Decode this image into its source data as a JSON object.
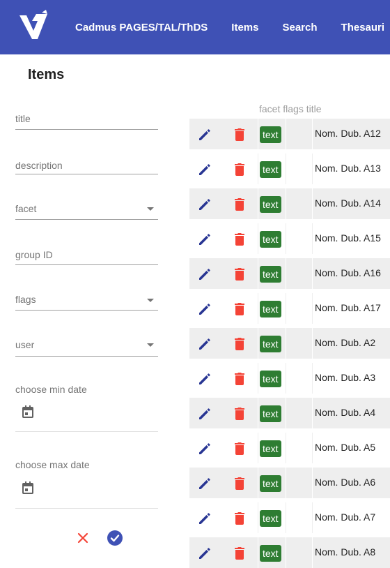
{
  "header": {
    "nav": [
      "Cadmus PAGES/TAL/ThDS",
      "Items",
      "Search",
      "Thesauri"
    ]
  },
  "page": {
    "title": "Items"
  },
  "filters": {
    "title_label": "title",
    "description_label": "description",
    "facet_label": "facet",
    "group_label": "group ID",
    "flags_label": "flags",
    "user_label": "user",
    "min_date_label": "choose min date",
    "max_date_label": "choose max date"
  },
  "table": {
    "header": "facet flags title",
    "rows": [
      {
        "flag": "text",
        "title": "Nom. Dub. A12"
      },
      {
        "flag": "text",
        "title": "Nom. Dub. A13"
      },
      {
        "flag": "text",
        "title": "Nom. Dub. A14"
      },
      {
        "flag": "text",
        "title": "Nom. Dub. A15"
      },
      {
        "flag": "text",
        "title": "Nom. Dub. A16"
      },
      {
        "flag": "text",
        "title": "Nom. Dub. A17"
      },
      {
        "flag": "text",
        "title": "Nom. Dub. A2"
      },
      {
        "flag": "text",
        "title": "Nom. Dub. A3"
      },
      {
        "flag": "text",
        "title": "Nom. Dub. A4"
      },
      {
        "flag": "text",
        "title": "Nom. Dub. A5"
      },
      {
        "flag": "text",
        "title": "Nom. Dub. A6"
      },
      {
        "flag": "text",
        "title": "Nom. Dub. A7"
      },
      {
        "flag": "text",
        "title": "Nom. Dub. A8"
      }
    ]
  },
  "colors": {
    "primary": "#3f51b5",
    "edit": "#283593",
    "delete": "#f44336",
    "chip": "#2e7d32"
  },
  "icons": {
    "logo": "cadmus-logo",
    "edit": "pencil-icon",
    "delete": "trash-icon",
    "calendar": "calendar-icon",
    "clear": "close-icon",
    "apply": "check-circle-icon"
  }
}
